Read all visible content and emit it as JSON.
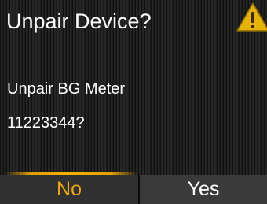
{
  "dialog": {
    "title": "Unpair Device?",
    "message_line1": "Unpair BG Meter",
    "message_line2": "11223344?",
    "icon": "warning-icon"
  },
  "softkeys": {
    "no_label": "No",
    "yes_label": "Yes",
    "selected": "No"
  },
  "colors": {
    "accent": "#f0a800",
    "warning_triangle": "#e6b400",
    "text": "#ffffff",
    "background": "#1a1a1a"
  }
}
